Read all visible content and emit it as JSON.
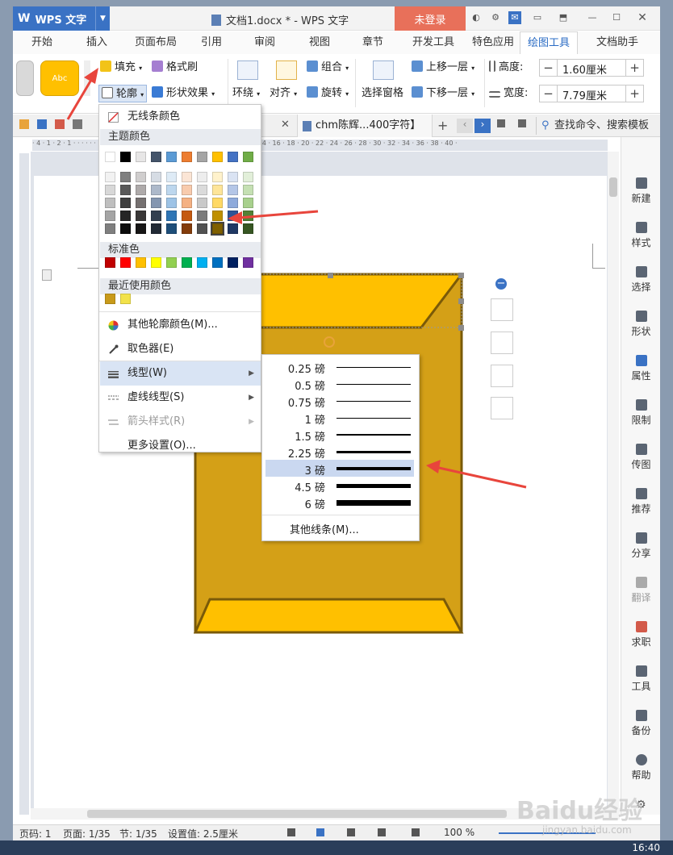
{
  "app": {
    "name": "WPS 文字",
    "doc_title": "文档1.docx * - WPS 文字",
    "login": "未登录"
  },
  "menu_tabs": [
    "开始",
    "插入",
    "页面布局",
    "引用",
    "审阅",
    "视图",
    "章节",
    "开发工具",
    "特色应用",
    "绘图工具",
    "文档助手"
  ],
  "ribbon": {
    "style_sample": "Abc",
    "fill": "填充",
    "format_painter": "格式刷",
    "outline": "轮廓",
    "shape_effect": "形状效果",
    "wrap": "环绕",
    "align": "对齐",
    "group": "组合",
    "rotate": "旋转",
    "selection_pane": "选择窗格",
    "bring_forward": "上移一层",
    "send_backward": "下移一层",
    "height_label": "高度:",
    "height_value": "1.60厘米",
    "width_label": "宽度:",
    "width_value": "7.79厘米"
  },
  "doc_tab": {
    "title": "chm陈辉...400字符】"
  },
  "search": {
    "placeholder": "查找命令、搜索模板"
  },
  "outline_menu": {
    "no_line": "无线条颜色",
    "theme_colors": "主题颜色",
    "standard_colors": "标准色",
    "recent_colors": "最近使用颜色",
    "more_colors": "其他轮廓颜色(M)...",
    "eyedropper": "取色器(E)",
    "line_type": "线型(W)",
    "dash_type": "虚线线型(S)",
    "arrow_style": "箭头样式(R)",
    "more_settings": "更多设置(O)..."
  },
  "theme_top_row": [
    "#ffffff",
    "#000000",
    "#e7e6e6",
    "#44546a",
    "#5b9bd5",
    "#ed7d31",
    "#a5a5a5",
    "#ffc000",
    "#4472c4",
    "#70ad47"
  ],
  "theme_shades": [
    [
      "#f2f2f2",
      "#7f7f7f",
      "#d0cece",
      "#d6dce4",
      "#deebf6",
      "#fbe5d5",
      "#ededed",
      "#fff2cc",
      "#dae3f3",
      "#e2efd9"
    ],
    [
      "#d8d8d8",
      "#595959",
      "#aeaaaa",
      "#adb9ca",
      "#bdd7ee",
      "#f8cbad",
      "#dbdbdb",
      "#fee599",
      "#b4c6e7",
      "#c5e0b3"
    ],
    [
      "#bfbfbf",
      "#3f3f3f",
      "#757070",
      "#8496b0",
      "#9dc3e6",
      "#f4b183",
      "#c9c9c9",
      "#ffd965",
      "#8eaadb",
      "#a8d08d"
    ],
    [
      "#a5a5a5",
      "#262626",
      "#3a3838",
      "#323f4f",
      "#2e75b5",
      "#c55a11",
      "#7b7b7b",
      "#bf9000",
      "#2f5496",
      "#538135"
    ],
    [
      "#7f7f7f",
      "#0c0c0c",
      "#171616",
      "#222a35",
      "#1e4e79",
      "#833c0b",
      "#525252",
      "#7f6000",
      "#1f3864",
      "#375623"
    ]
  ],
  "standard_color_list": [
    "#c00000",
    "#ff0000",
    "#ffc000",
    "#ffff00",
    "#92d050",
    "#00b050",
    "#00b0f0",
    "#0070c0",
    "#002060",
    "#7030a0"
  ],
  "recent_color_list": [
    "#c89a1a",
    "#f2e24a"
  ],
  "line_weights": [
    {
      "label": "0.25 磅",
      "thickness": 0.25
    },
    {
      "label": "0.5 磅",
      "thickness": 0.5
    },
    {
      "label": "0.75 磅",
      "thickness": 0.75
    },
    {
      "label": "1 磅",
      "thickness": 1
    },
    {
      "label": "1.5 磅",
      "thickness": 1.5
    },
    {
      "label": "2.25 磅",
      "thickness": 2.25
    },
    {
      "label": "3 磅",
      "thickness": 3,
      "selected": true
    },
    {
      "label": "4.5 磅",
      "thickness": 4.5
    },
    {
      "label": "6 磅",
      "thickness": 6
    }
  ],
  "more_lines": "其他线条(M)...",
  "right_panel": [
    "新建",
    "样式",
    "选择",
    "形状",
    "属性",
    "限制",
    "传图",
    "推荐",
    "分享",
    "翻译",
    "求职",
    "工具",
    "备份",
    "帮助"
  ],
  "status": {
    "page": "页码: 1",
    "pages": "页面: 1/35",
    "section": "节: 1/35",
    "setting": "设置值: 2.5厘米",
    "zoom": "100 %"
  },
  "clock": "16:40",
  "watermark": "Baidu经验",
  "watermark_url": "jingyan.baidu.com",
  "colors": {
    "accent": "#2b6cc4",
    "shape_fill": "#d4a017",
    "shape_light": "#ffc000",
    "shape_border": "#7a5a08"
  }
}
